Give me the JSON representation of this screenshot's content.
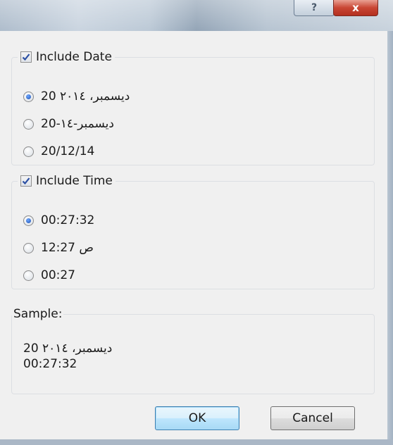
{
  "window": {
    "help_glyph": "?",
    "close_glyph": "x"
  },
  "date_group": {
    "checkbox_label": "Include Date",
    "checked": true,
    "options": [
      {
        "label": "20 ديسمبر، ٢٠١٤",
        "selected": true
      },
      {
        "label": "20-ديسمبر-١٤",
        "selected": false
      },
      {
        "label": "20/12/14",
        "selected": false
      }
    ]
  },
  "time_group": {
    "checkbox_label": "Include Time",
    "checked": true,
    "options": [
      {
        "label": "00:27:32",
        "selected": true
      },
      {
        "label": "12:27 ص",
        "selected": false
      },
      {
        "label": "00:27",
        "selected": false
      }
    ]
  },
  "sample": {
    "legend": "Sample:",
    "line1": "20 ديسمبر، ٢٠١٤",
    "line2": "00:27:32"
  },
  "buttons": {
    "ok": "OK",
    "cancel": "Cancel"
  },
  "colors": {
    "check_mark": "#2b4fa3",
    "close_button": "#c94634"
  }
}
